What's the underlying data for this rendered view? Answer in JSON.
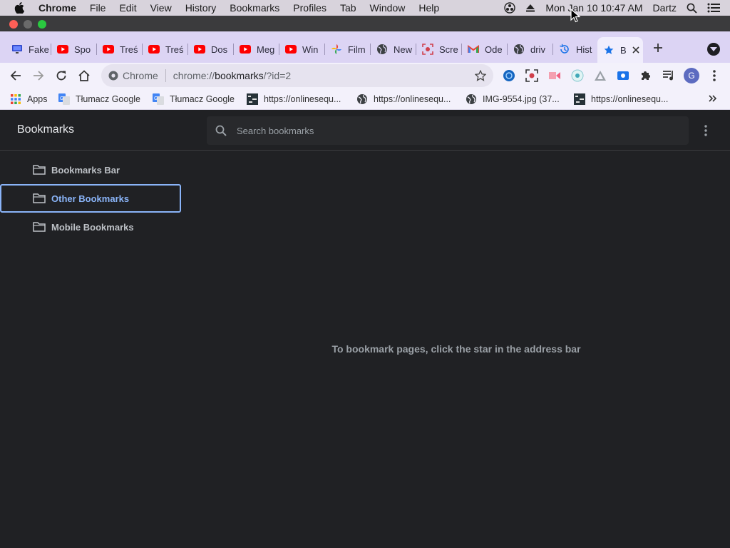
{
  "menubar": {
    "app_name": "Chrome",
    "items": [
      "File",
      "Edit",
      "View",
      "History",
      "Bookmarks",
      "Profiles",
      "Tab",
      "Window",
      "Help"
    ],
    "datetime": "Mon Jan 10  10:47 AM",
    "user": "Dartz"
  },
  "tabs": [
    {
      "label": "Fake",
      "favicon": "monitor-icon"
    },
    {
      "label": "Spo",
      "favicon": "youtube-icon"
    },
    {
      "label": "Treś",
      "favicon": "youtube-icon"
    },
    {
      "label": "Treś",
      "favicon": "youtube-icon"
    },
    {
      "label": "Dos",
      "favicon": "youtube-icon"
    },
    {
      "label": "Meg",
      "favicon": "youtube-icon"
    },
    {
      "label": "Win",
      "favicon": "youtube-icon"
    },
    {
      "label": "Film",
      "favicon": "google-photos-icon"
    },
    {
      "label": "New",
      "favicon": "globe-icon"
    },
    {
      "label": "Scre",
      "favicon": "screen-record-icon"
    },
    {
      "label": "Ode",
      "favicon": "gmail-icon"
    },
    {
      "label": "driv",
      "favicon": "globe-icon"
    },
    {
      "label": "Hist",
      "favicon": "history-icon"
    },
    {
      "label": "B",
      "favicon": "star-icon",
      "active": true
    }
  ],
  "omnibox": {
    "scheme_label": "Chrome",
    "url_prefix": "chrome://",
    "url_host": "bookmarks",
    "url_rest": "/?id=2"
  },
  "profile_initial": "G",
  "bookmarks_bar": [
    {
      "label": "Apps",
      "icon": "apps-grid-icon"
    },
    {
      "label": "Tłumacz Google",
      "icon": "google-translate-icon"
    },
    {
      "label": "Tłumacz Google",
      "icon": "google-translate-icon"
    },
    {
      "label": "https://onlinesequ...",
      "icon": "sequencer-icon"
    },
    {
      "label": "https://onlinesequ...",
      "icon": "globe-icon"
    },
    {
      "label": "IMG-9554.jpg (37...",
      "icon": "globe-icon"
    },
    {
      "label": "https://onlinesequ...",
      "icon": "sequencer-icon"
    }
  ],
  "manager": {
    "title": "Bookmarks",
    "search_placeholder": "Search bookmarks",
    "folders": [
      {
        "label": "Bookmarks Bar",
        "selected": false
      },
      {
        "label": "Other Bookmarks",
        "selected": true
      },
      {
        "label": "Mobile Bookmarks",
        "selected": false
      }
    ],
    "empty_message": "To bookmark pages, click the star in the address bar"
  },
  "colors": {
    "accent": "#8ab4f8",
    "page_bg": "#202124",
    "tabstrip_bg": "#dcd4f4",
    "youtube_red": "#ff0000"
  }
}
